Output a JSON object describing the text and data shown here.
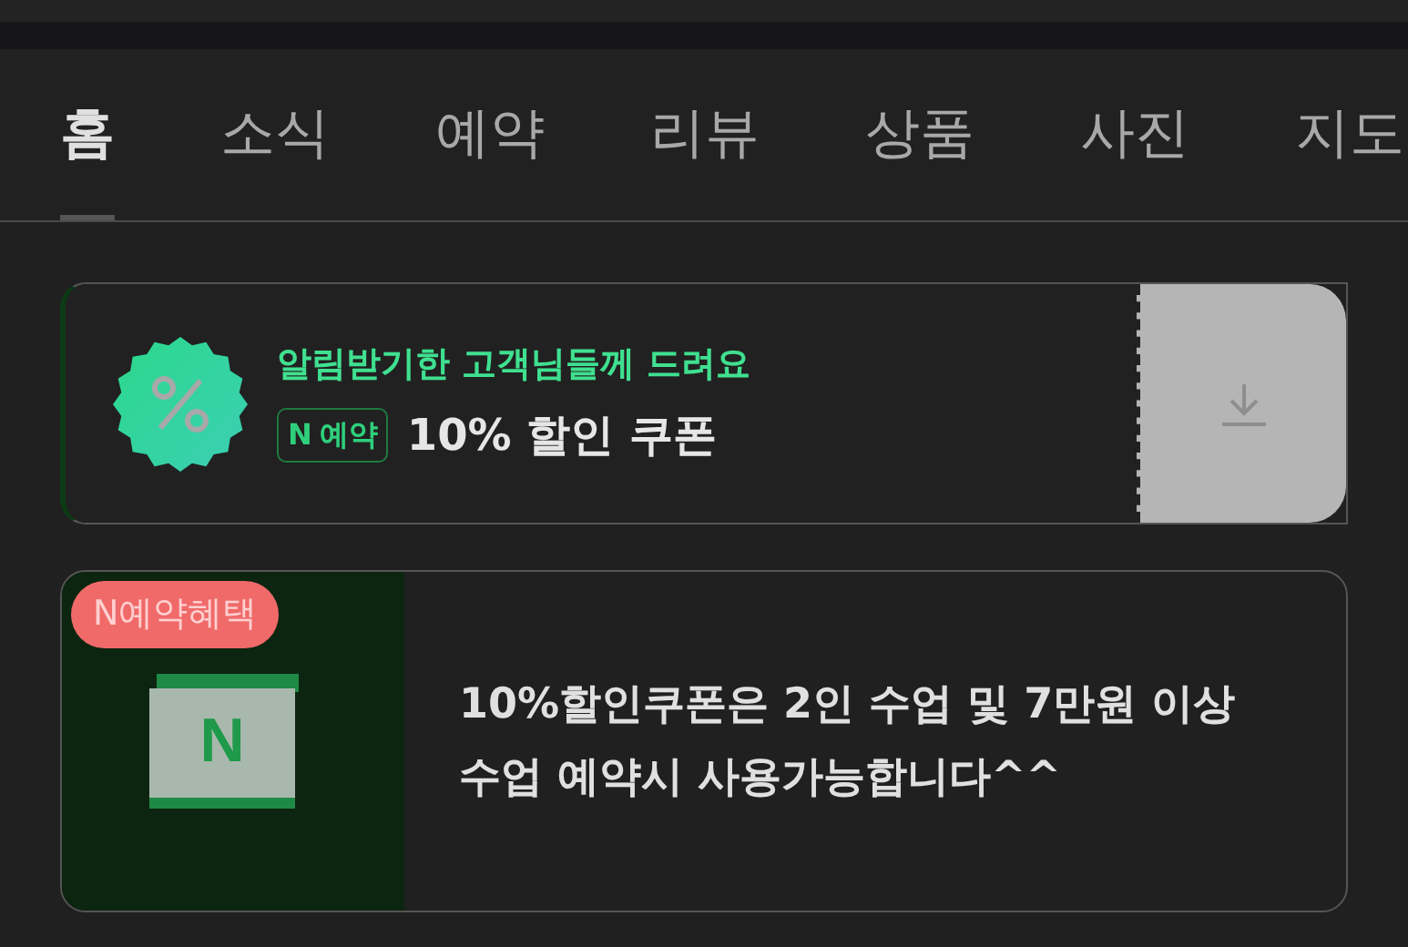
{
  "tabs": [
    {
      "label": "홈",
      "selected": true
    },
    {
      "label": "소식",
      "selected": false
    },
    {
      "label": "예약",
      "selected": false
    },
    {
      "label": "리뷰",
      "selected": false
    },
    {
      "label": "상품",
      "selected": false
    },
    {
      "label": "사진",
      "selected": false
    },
    {
      "label": "지도",
      "selected": false
    }
  ],
  "coupon": {
    "headline": "알림받기한 고객님들께 드려요",
    "badge_letter": "N",
    "badge_label": "예약",
    "title": "10% 할인 쿠폰"
  },
  "benefit": {
    "tag": "N예약혜택",
    "icon_letter": "N",
    "text": "10%할인쿠폰은 2인 수업 및 7만원 이상 수업 예약시 사용가능합니다^^"
  }
}
